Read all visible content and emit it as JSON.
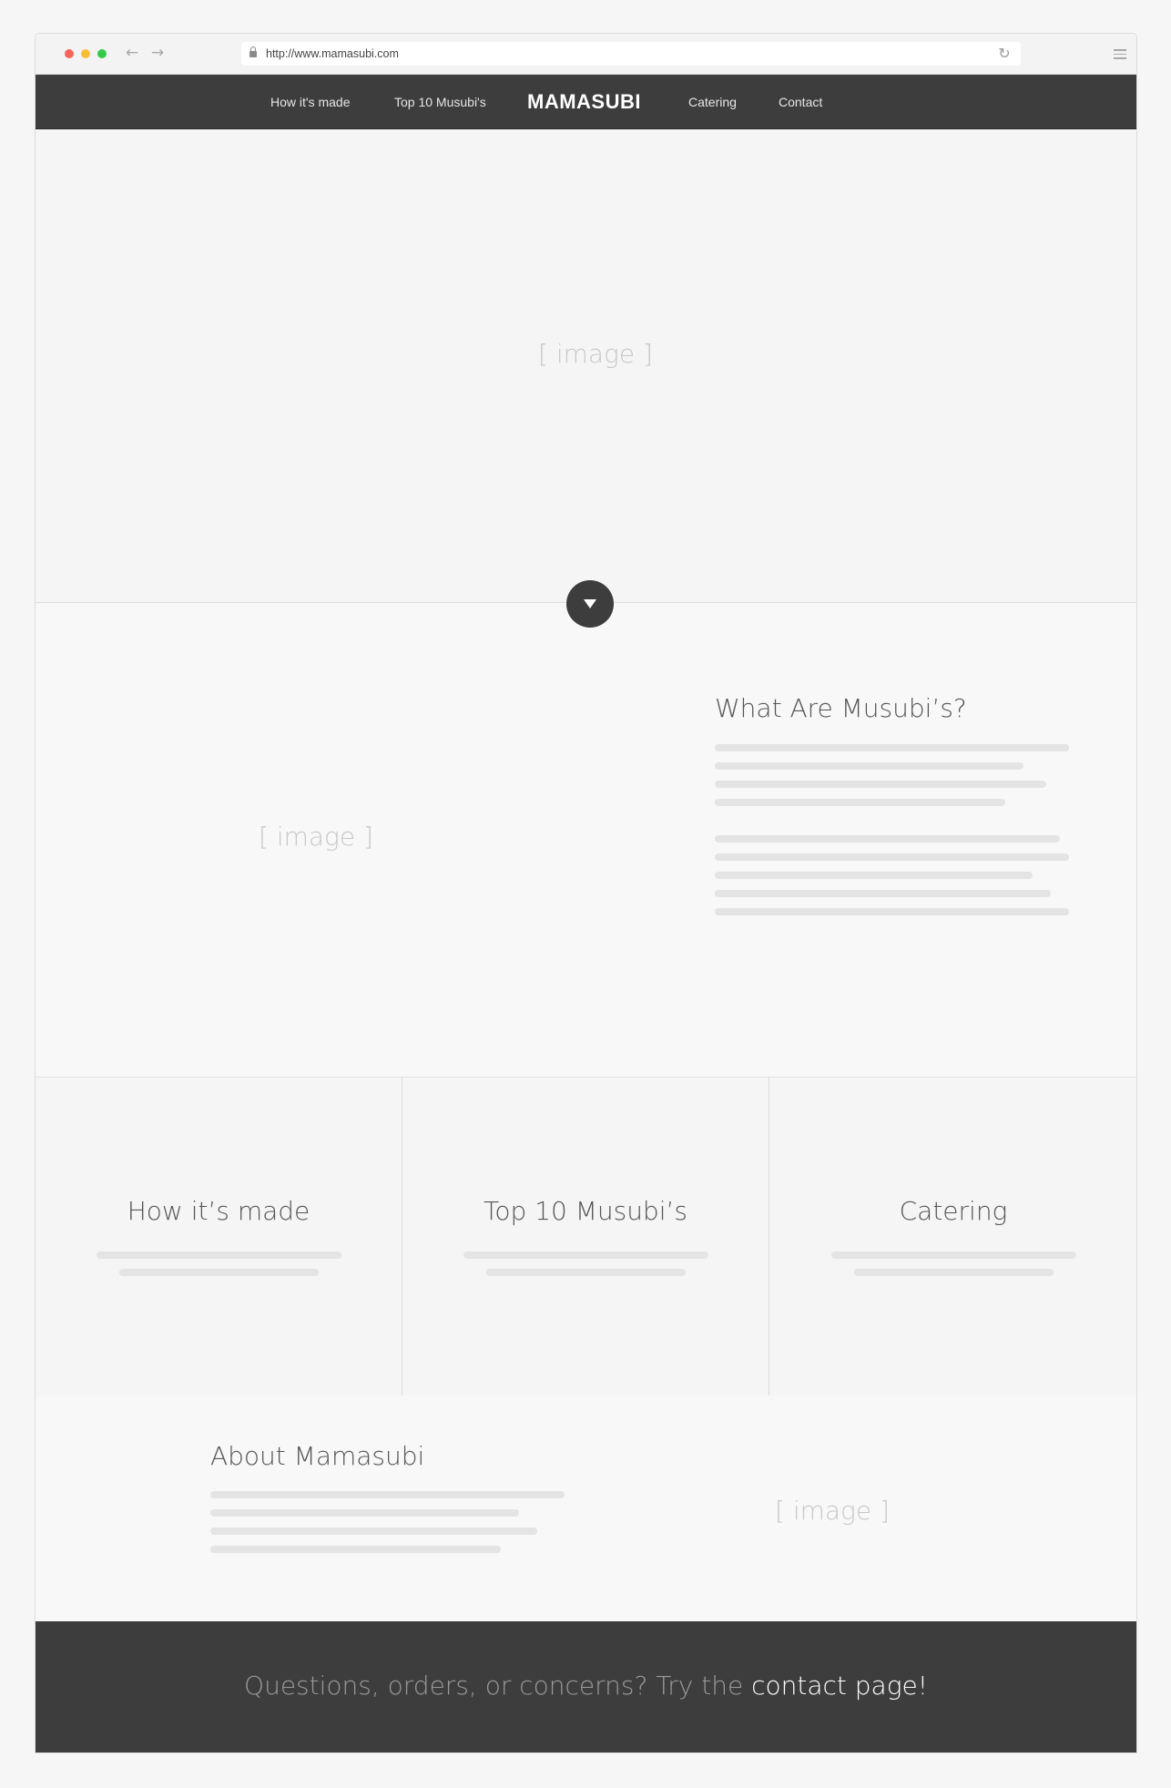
{
  "browser": {
    "url": "http://www.mamasubi.com"
  },
  "nav": {
    "how_label": "How it's made",
    "top10_label": "Top 10 Musubi's",
    "brand": "MAMASUBI",
    "catering_label": "Catering",
    "contact_label": "Contact"
  },
  "hero": {
    "image_placeholder": "[ image ]"
  },
  "what": {
    "heading": "What Are Musubi’s?",
    "image_placeholder": "[ image ]"
  },
  "cards": [
    {
      "title": "How it’s made"
    },
    {
      "title": "Top 10 Musubi’s"
    },
    {
      "title": "Catering"
    }
  ],
  "about": {
    "heading": "About Mamasubi",
    "image_placeholder": "[ image ]"
  },
  "footer": {
    "text": "Questions, orders, or concerns? Try the ",
    "link_text": "contact page!"
  }
}
